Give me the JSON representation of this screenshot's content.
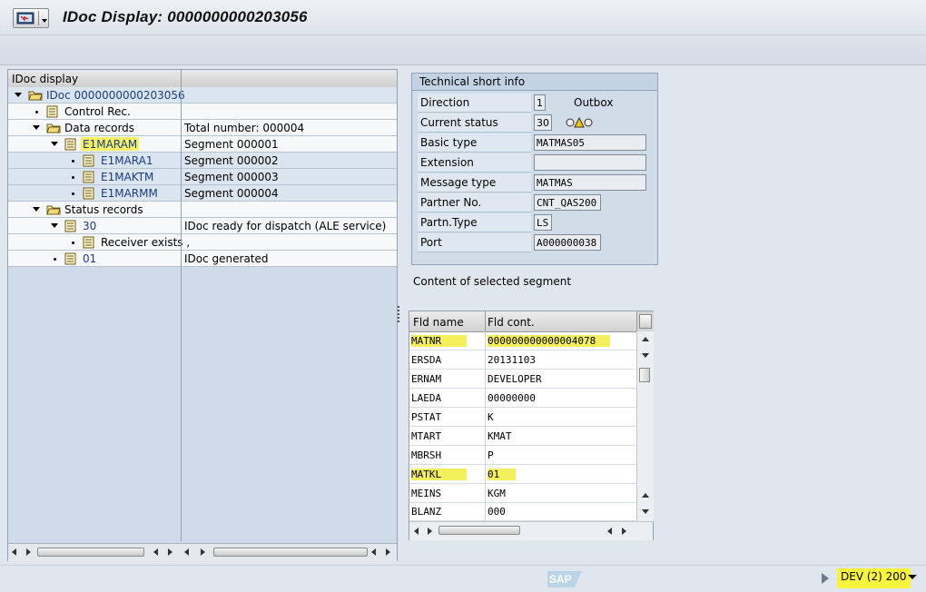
{
  "window": {
    "title": "IDoc Display: 0000000000203056"
  },
  "tree": {
    "header": "IDoc display",
    "rows": [
      {
        "label": "IDoc 0000000000203056",
        "value": ""
      },
      {
        "label": "Control Rec.",
        "value": ""
      },
      {
        "label": "Data records",
        "value": "Total number: 000004"
      },
      {
        "label": "E1MARAM",
        "value": "Segment 000001",
        "highlighted": true
      },
      {
        "label": "E1MARA1",
        "value": "Segment 000002"
      },
      {
        "label": "E1MAKTM",
        "value": "Segment 000003"
      },
      {
        "label": "E1MARMM",
        "value": "Segment 000004"
      },
      {
        "label": "Status records",
        "value": ""
      },
      {
        "label": "30",
        "value": "IDoc ready for dispatch (ALE service)"
      },
      {
        "label": "Receiver exists ,",
        "value": ""
      },
      {
        "label": "01",
        "value": "IDoc generated"
      }
    ]
  },
  "tech": {
    "header": "Technical short info",
    "fields": [
      {
        "label": "Direction",
        "value": "1",
        "extra": "Outbox"
      },
      {
        "label": "Current status",
        "value": "30",
        "extra_icon": "traffic-light-icon"
      },
      {
        "label": "Basic type",
        "value": "MATMAS05"
      },
      {
        "label": "Extension",
        "value": ""
      },
      {
        "label": "Message type",
        "value": "MATMAS"
      },
      {
        "label": "Partner No.",
        "value": "CNT_QAS200"
      },
      {
        "label": "Partn.Type",
        "value": "LS"
      },
      {
        "label": "Port",
        "value": "A000000038"
      }
    ]
  },
  "segment": {
    "caption": "Content of selected segment",
    "col_name": "Fld name",
    "col_cont": "Fld cont.",
    "rows": [
      {
        "name": "MATNR",
        "cont": "000000000000004078",
        "highlighted": true
      },
      {
        "name": "ERSDA",
        "cont": "20131103"
      },
      {
        "name": "ERNAM",
        "cont": "DEVELOPER"
      },
      {
        "name": "LAEDA",
        "cont": "00000000"
      },
      {
        "name": "PSTAT",
        "cont": "K"
      },
      {
        "name": "MTART",
        "cont": "KMAT"
      },
      {
        "name": "MBRSH",
        "cont": "P"
      },
      {
        "name": "MATKL",
        "cont": "01",
        "highlighted": true
      },
      {
        "name": "MEINS",
        "cont": "KGM"
      },
      {
        "name": "BLANZ",
        "cont": "000"
      }
    ]
  },
  "status": {
    "logo": "SAP",
    "system": "DEV (2) 200"
  },
  "colors": {
    "highlight": "#f6f266",
    "tree_bg": "#cfdbe8",
    "link": "#1b3c80"
  }
}
